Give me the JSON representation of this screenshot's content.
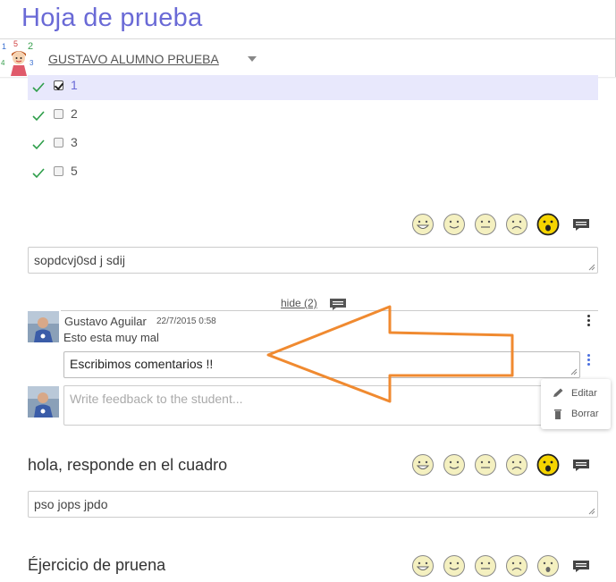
{
  "header": {
    "title": "Hoja de prueba",
    "student_name": "GUSTAVO ALUMNO PRUEBA"
  },
  "options": [
    {
      "label": "1",
      "checked": true,
      "correct": true
    },
    {
      "label": "2",
      "checked": false,
      "correct": true
    },
    {
      "label": "3",
      "checked": false,
      "correct": true
    },
    {
      "label": "5",
      "checked": false,
      "correct": true
    }
  ],
  "rating_faces": [
    "big-smile-face-icon",
    "smile-face-icon",
    "neutral-face-icon",
    "sad-face-icon",
    "surprised-face-icon"
  ],
  "answer1": {
    "text": "sopdcvj0sd j sdij"
  },
  "comments": {
    "hide_link": "hide (2)",
    "author": "Gustavo Aguilar",
    "date": "22/7/2015 0:58",
    "text": "Esto esta muy mal",
    "edit_value": "Escribimos comentarios !!",
    "feedback_placeholder": "Write feedback to the student...",
    "menu": {
      "edit": "Editar",
      "delete": "Borrar"
    }
  },
  "question2": {
    "title": "hola, responde en el cuadro",
    "answer": "pso jops jpdo"
  },
  "question3": {
    "title": "Éjercicio de pruena"
  },
  "colors": {
    "title": "#6a6ad6",
    "highlight": "#e8e8fc",
    "tick": "#2e9e4a",
    "face_selected": "#f5d400",
    "arrow": "#f08a30",
    "menu_dots": "#4a6fe0"
  }
}
